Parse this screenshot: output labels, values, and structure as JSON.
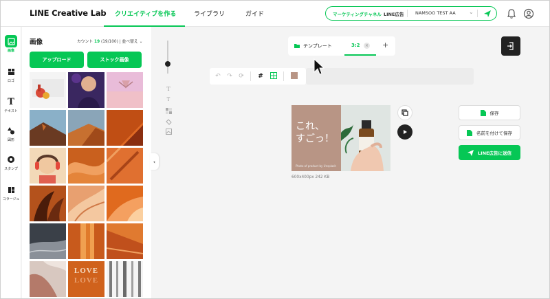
{
  "header": {
    "logo": "LINE Creative Lab",
    "nav": [
      "クリエイティブを作る",
      "ライブラリ",
      "ガイド"
    ],
    "account": {
      "channel": "マーケティングチャネル",
      "ad_label": "LINE広告",
      "name": "NAMSOO TEST AA"
    }
  },
  "rail": [
    {
      "label": "画像",
      "icon": "image-icon"
    },
    {
      "label": "ロゴ",
      "icon": "logo-icon"
    },
    {
      "label": "テキスト",
      "icon": "text-icon"
    },
    {
      "label": "図形",
      "icon": "shape-icon"
    },
    {
      "label": "スタンプ",
      "icon": "stamp-icon"
    },
    {
      "label": "コラージュ",
      "icon": "collage-icon"
    }
  ],
  "panel": {
    "title": "画像",
    "count_label": "カウント",
    "count_value": "19",
    "count_detail": "(19/100) | 並べ替え",
    "upload": "アップロード",
    "stock": "ストック画像"
  },
  "thumbs": [
    {
      "bg": "#f1f1f1",
      "accent": "#d94b3a"
    },
    {
      "bg": "#3b2a5e",
      "accent": "#e0b090"
    },
    {
      "bg": "#e6b9d9",
      "accent": "#d9a0a8"
    },
    {
      "bg": "#6a4a3a",
      "accent": "#c76a2a"
    },
    {
      "bg": "#8aa5b8",
      "accent": "#c77030"
    },
    {
      "bg": "#d0601e",
      "accent": "#8a2e10"
    },
    {
      "bg": "#f2d9b8",
      "accent": "#e4483a"
    },
    {
      "bg": "#c9601e",
      "accent": "#f0a060"
    },
    {
      "bg": "#e07030",
      "accent": "#a84418"
    },
    {
      "bg": "#b4521c",
      "accent": "#4a1c0a"
    },
    {
      "bg": "#e8a070",
      "accent": "#f4c8a0"
    },
    {
      "bg": "#e06a1e",
      "accent": "#f4a060"
    },
    {
      "bg": "#3a4048",
      "accent": "#8a9098"
    },
    {
      "bg": "#c85a1c",
      "accent": "#f0a050"
    },
    {
      "bg": "#e07a30",
      "accent": "#c0501c"
    },
    {
      "bg": "#d8c8c0",
      "accent": "#b47a6a"
    },
    {
      "bg": "#d0621c",
      "accent": "#f4dcc4"
    },
    {
      "bg": "#7a7a7a",
      "accent": "#f4f4f4"
    }
  ],
  "love_text": "LOVE",
  "template": {
    "label": "テンプレート",
    "ratio": "3:2"
  },
  "canvas": {
    "line1": "これ、",
    "line2": "すごっ！",
    "caption": "Photo of product by Unsplash",
    "info": "600x400px    242 KB"
  },
  "actions": {
    "save": "保存",
    "save_as": "名前を付けて保存",
    "send": "LINE広告に送信"
  },
  "colors": {
    "brand": "#06c755",
    "dark": "#222222"
  }
}
